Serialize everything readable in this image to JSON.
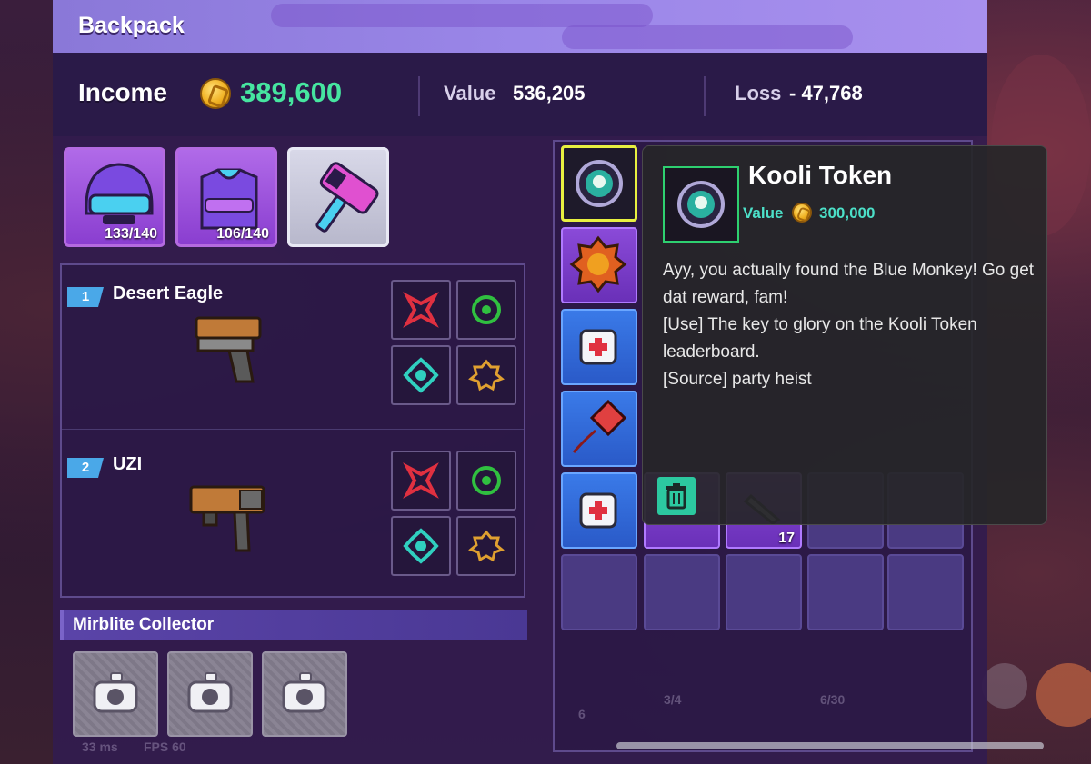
{
  "window": {
    "title": "Backpack"
  },
  "stats": {
    "income_label": "Income",
    "income_value": "389,600",
    "value_label": "Value",
    "value_value": "536,205",
    "loss_label": "Loss",
    "loss_value": "- 47,768"
  },
  "gear": [
    {
      "name": "helmet",
      "count": "133/140"
    },
    {
      "name": "armor-vest",
      "count": "106/140"
    },
    {
      "name": "hammer",
      "count": ""
    }
  ],
  "weapons": [
    {
      "slot": "1",
      "name": "Desert Eagle"
    },
    {
      "slot": "2",
      "name": "UZI"
    }
  ],
  "collector": {
    "title": "Mirblite Collector"
  },
  "inventory": {
    "stack_count": "17"
  },
  "tooltip": {
    "name": "Kooli Token",
    "value_label": "Value",
    "value": "300,000",
    "desc_line1": "Ayy, you actually found the Blue Monkey! Go get dat reward, fam!",
    "desc_line2": "[Use] The key to glory on the Kooli Token leaderboard.",
    "desc_line3": "[Source] party heist"
  },
  "hud": {
    "ping": "33 ms",
    "fps": "FPS 60",
    "count_a": "3/4",
    "count_b": "6/30",
    "count_c": "6"
  },
  "colors": {
    "income": "#46e6a0",
    "accent_title": "#9a86e8",
    "selected_border": "#e8f040",
    "tooltip_value": "#4ce0c8",
    "trash_button": "#2cc8a0"
  }
}
